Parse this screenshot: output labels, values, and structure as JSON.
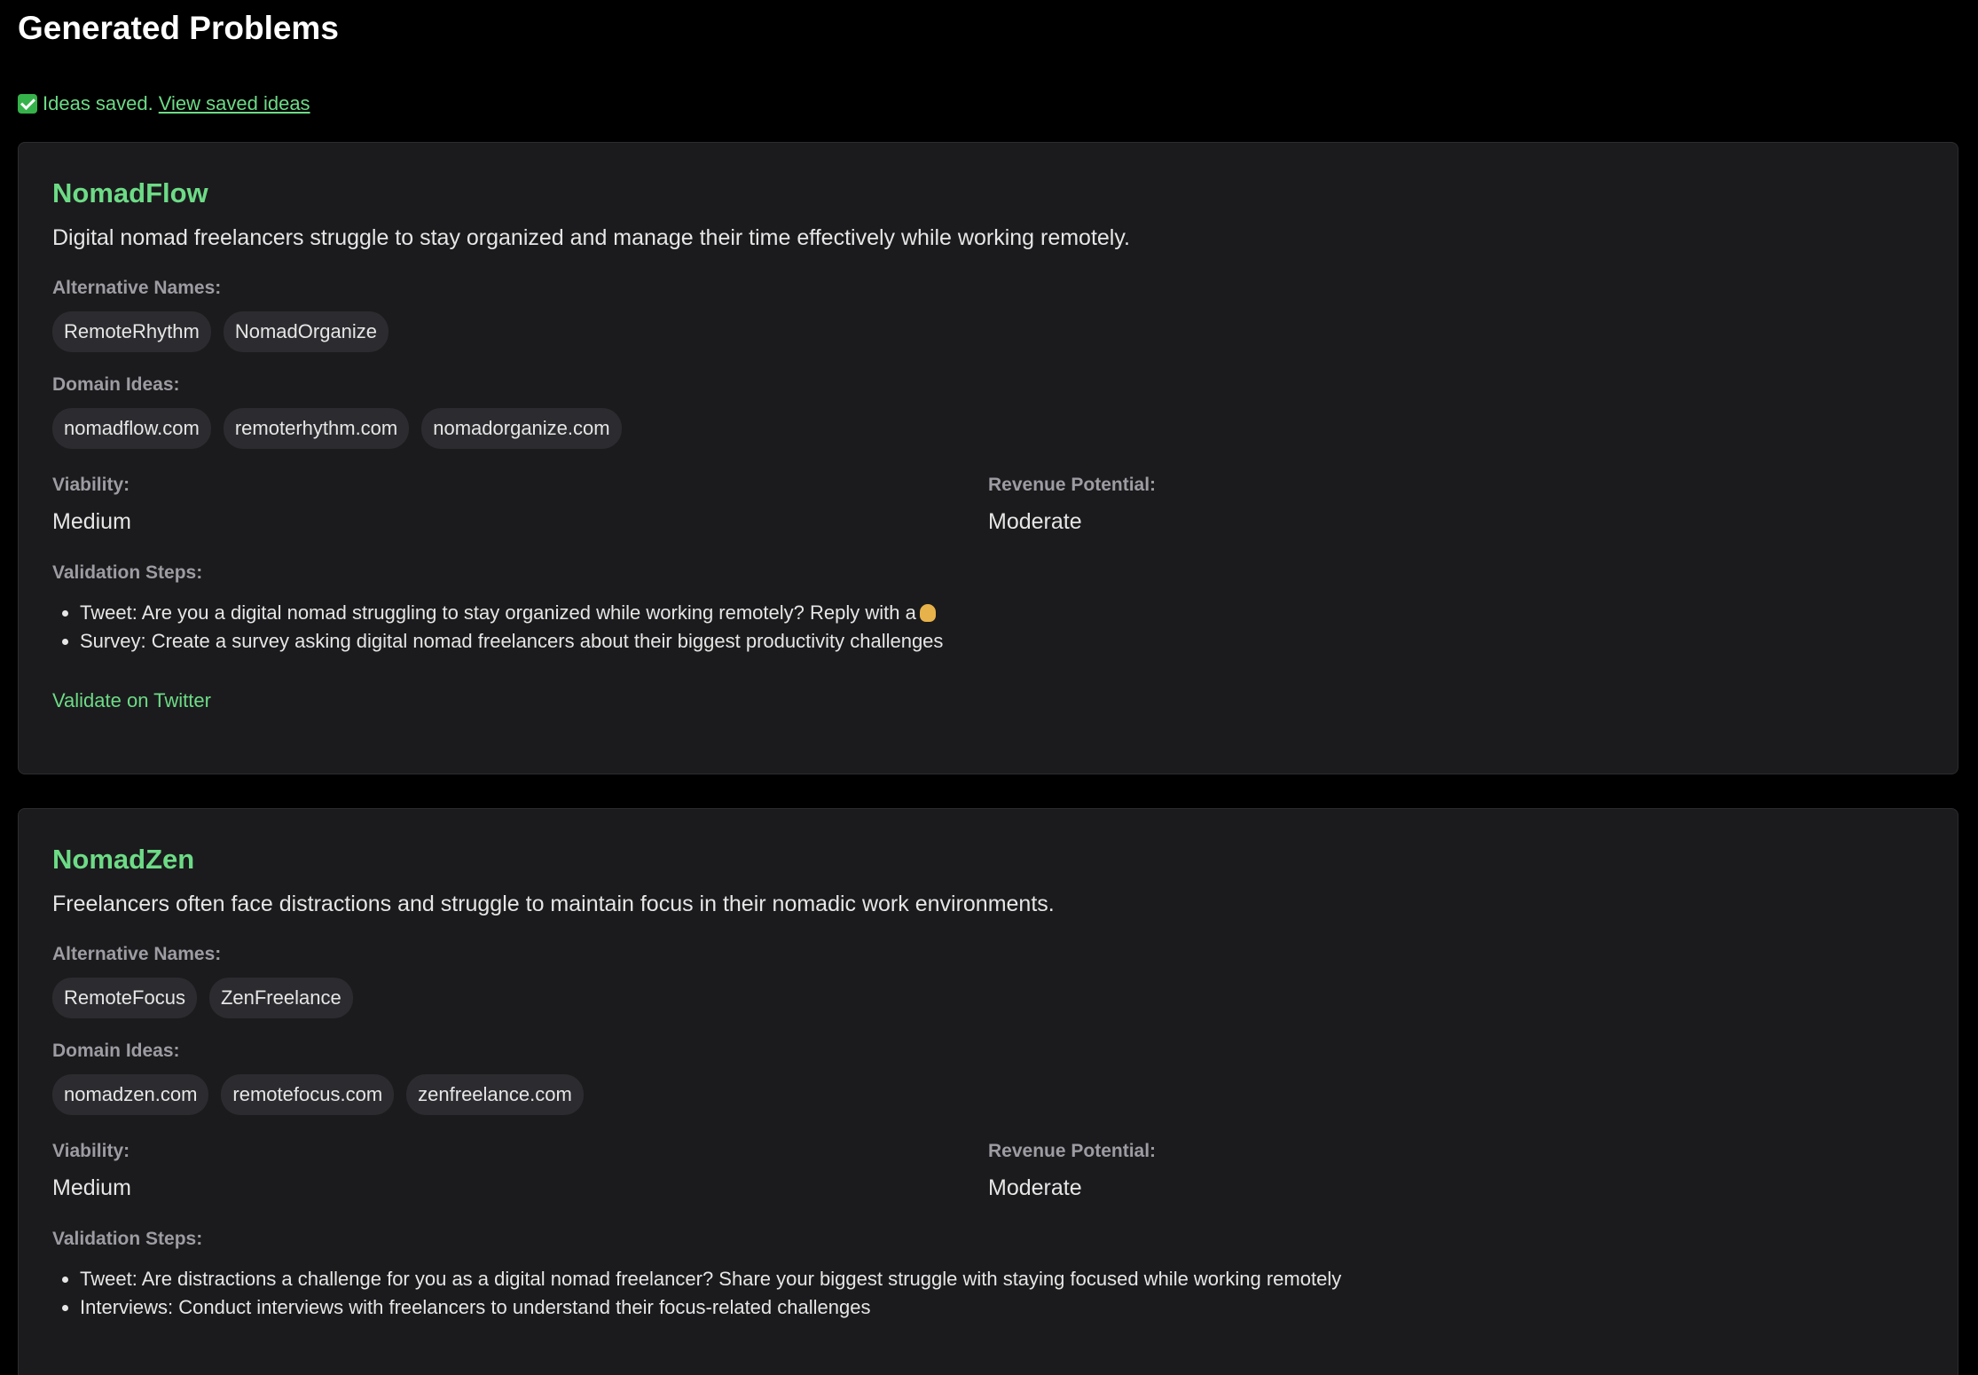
{
  "page": {
    "title": "Generated Problems",
    "saved_message": "Ideas saved.",
    "saved_link": "View saved ideas",
    "check_icon": "check-mark-icon"
  },
  "labels": {
    "alternative_names": "Alternative Names:",
    "domain_ideas": "Domain Ideas:",
    "viability": "Viability:",
    "revenue_potential": "Revenue Potential:",
    "validation_steps": "Validation Steps:"
  },
  "ideas": [
    {
      "name": "NomadFlow",
      "description": "Digital nomad freelancers struggle to stay organized and manage their time effectively while working remotely.",
      "alternative_names": [
        "RemoteRhythm",
        "NomadOrganize"
      ],
      "domains": [
        "nomadflow.com",
        "remoterhythm.com",
        "nomadorganize.com"
      ],
      "viability": "Medium",
      "revenue_potential": "Moderate",
      "steps": [
        "Tweet: Are you a digital nomad struggling to stay organized while working remotely? Reply with a",
        "Survey: Create a survey asking digital nomad freelancers about their biggest productivity challenges"
      ],
      "step_emoji": "person-raising-hand-emoji",
      "validate_link": "Validate on Twitter"
    },
    {
      "name": "NomadZen",
      "description": "Freelancers often face distractions and struggle to maintain focus in their nomadic work environments.",
      "alternative_names": [
        "RemoteFocus",
        "ZenFreelance"
      ],
      "domains": [
        "nomadzen.com",
        "remotefocus.com",
        "zenfreelance.com"
      ],
      "viability": "Medium",
      "revenue_potential": "Moderate",
      "steps": [
        "Tweet: Are distractions a challenge for you as a digital nomad freelancer? Share your biggest struggle with staying focused while working remotely",
        "Interviews: Conduct interviews with freelancers to understand their focus-related challenges"
      ]
    }
  ],
  "colors": {
    "background": "#000000",
    "card": "#1b1b1d",
    "chip": "#2c2c30",
    "accent": "#6ddb86",
    "label": "#9c9ca2"
  }
}
